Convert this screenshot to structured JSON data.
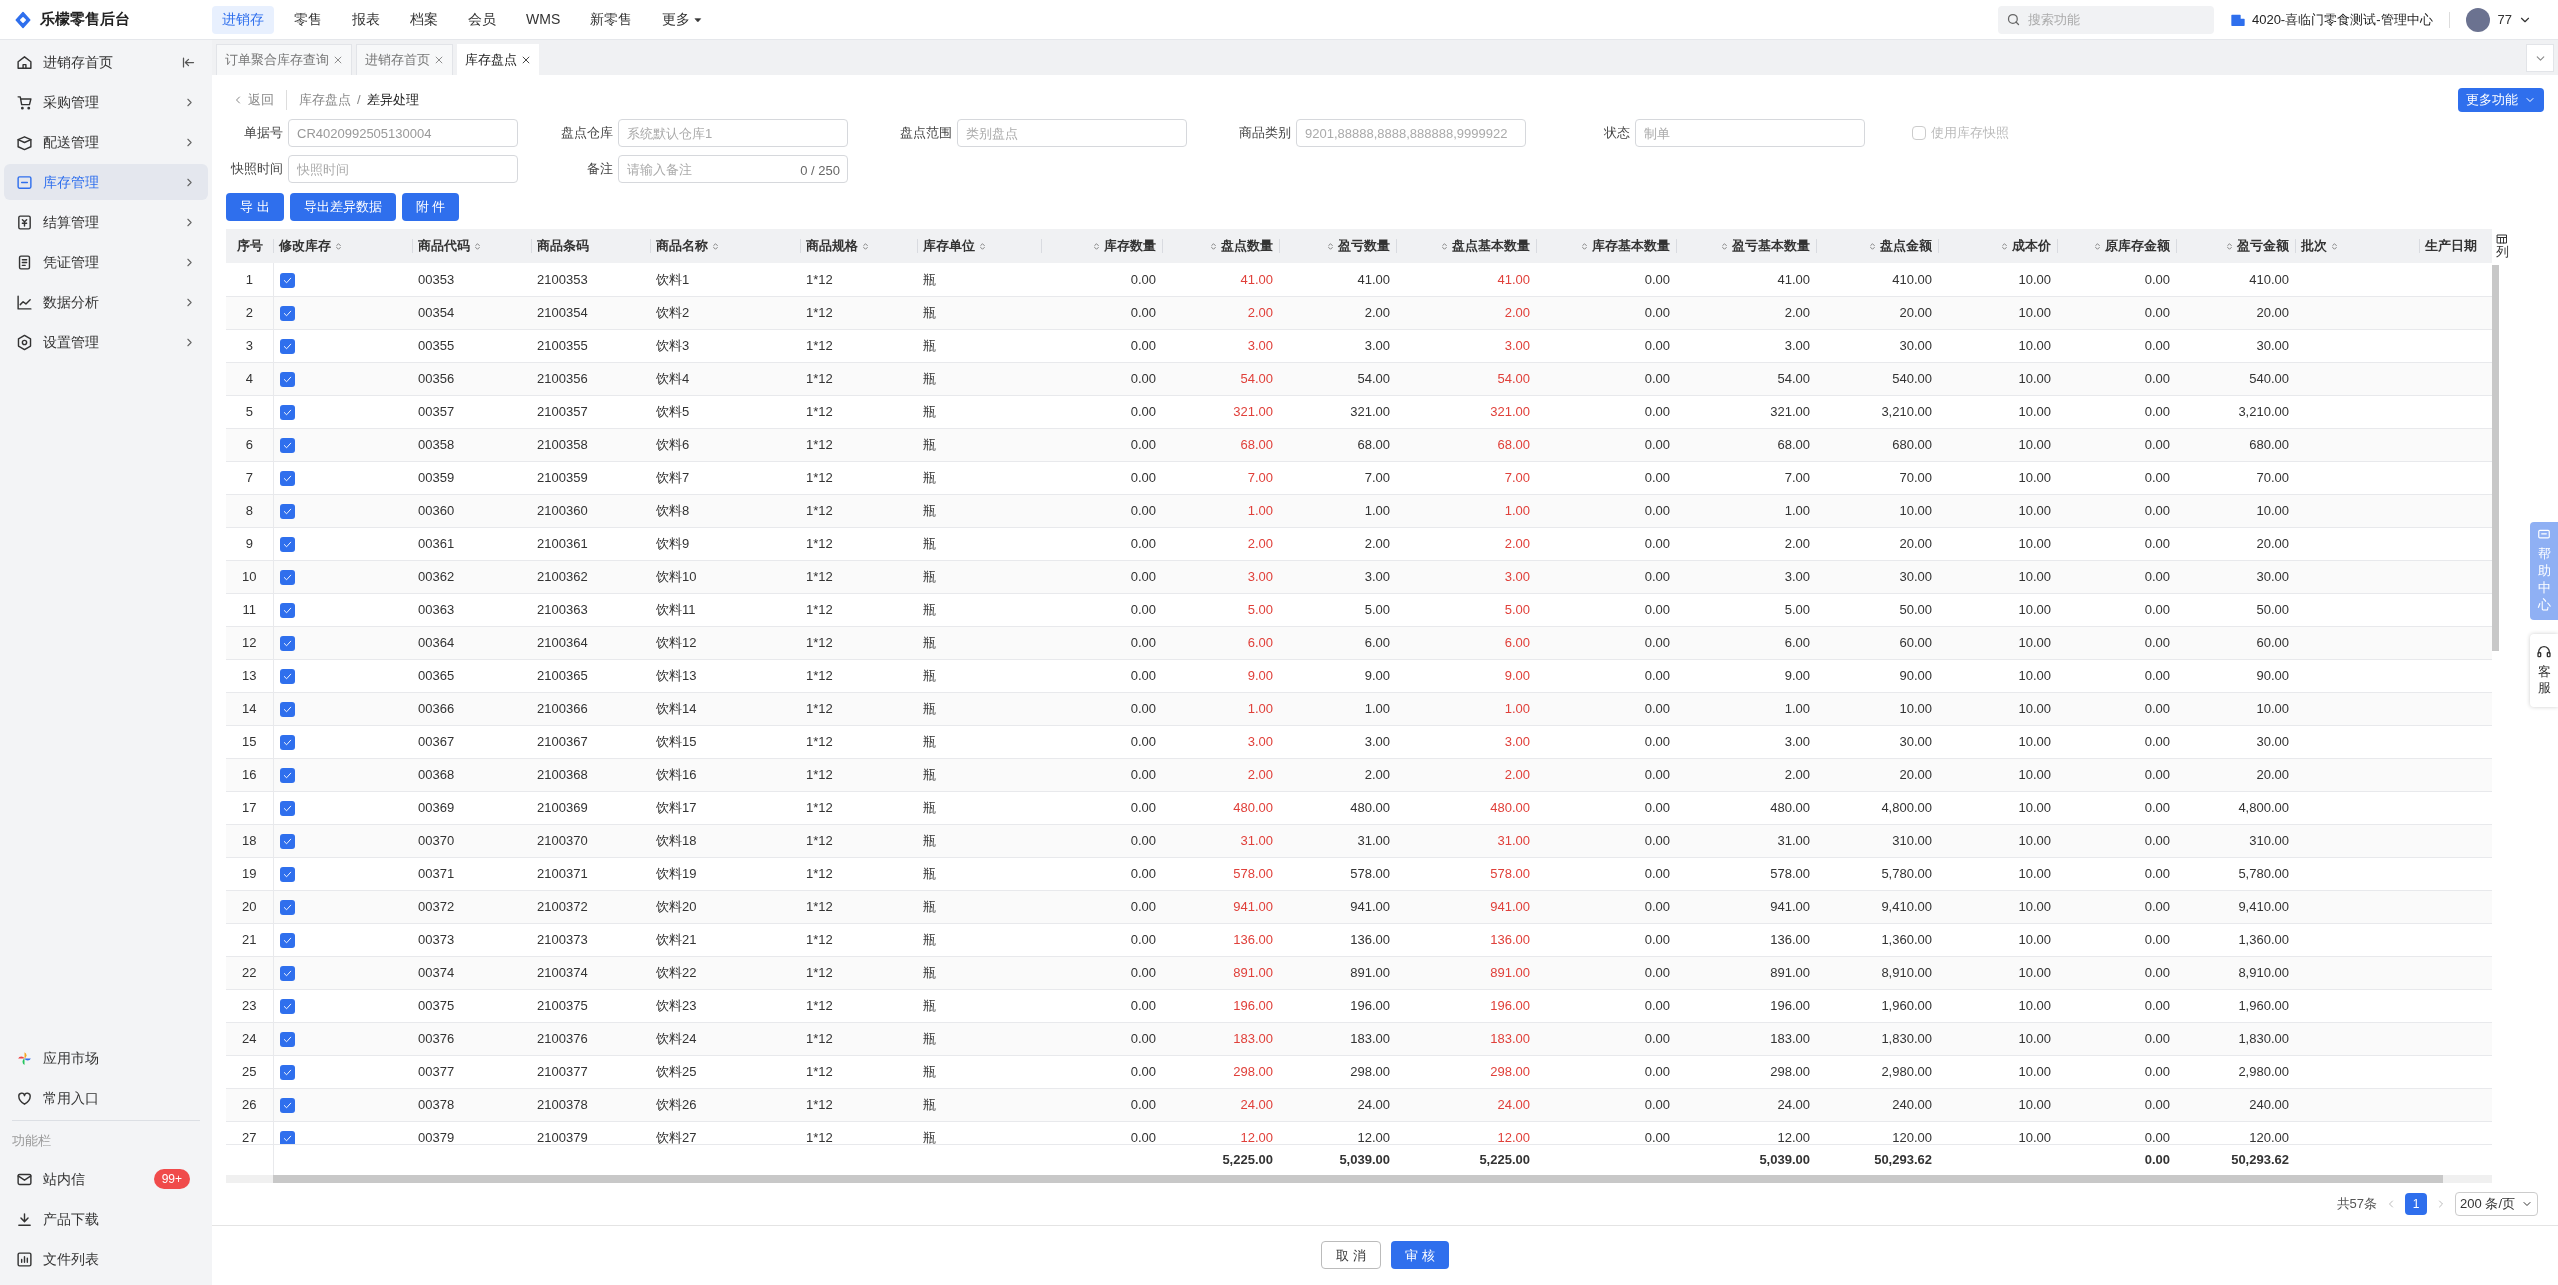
{
  "app": {
    "title": "乐檬零售后台"
  },
  "top_nav": [
    {
      "label": "进销存",
      "selected": true
    },
    {
      "label": "零售",
      "selected": false
    },
    {
      "label": "报表",
      "selected": false
    },
    {
      "label": "档案",
      "selected": false
    },
    {
      "label": "会员",
      "selected": false
    },
    {
      "label": "WMS",
      "selected": false
    },
    {
      "label": "新零售",
      "selected": false
    },
    {
      "label": "更多",
      "selected": false,
      "dropdown": true
    }
  ],
  "search": {
    "placeholder": "搜索功能"
  },
  "org": "4020-喜临门零食测试-管理中心",
  "user": "77",
  "sidebar": {
    "items": [
      {
        "label": "进销存首页",
        "selected": false
      },
      {
        "label": "采购管理",
        "selected": false
      },
      {
        "label": "配送管理",
        "selected": false
      },
      {
        "label": "库存管理",
        "selected": true
      },
      {
        "label": "结算管理",
        "selected": false
      },
      {
        "label": "凭证管理",
        "selected": false
      },
      {
        "label": "数据分析",
        "selected": false
      },
      {
        "label": "设置管理",
        "selected": false
      }
    ],
    "bottom": [
      {
        "label": "应用市场"
      },
      {
        "label": "常用入口"
      }
    ],
    "section": "功能栏",
    "tools": [
      {
        "label": "站内信",
        "badge": "99+"
      },
      {
        "label": "产品下载"
      },
      {
        "label": "文件列表"
      }
    ]
  },
  "tabs": [
    {
      "label": "订单聚合库存查询",
      "selected": false
    },
    {
      "label": "进销存首页",
      "selected": false
    },
    {
      "label": "库存盘点",
      "selected": true
    }
  ],
  "breadcrumb": {
    "back": "返回",
    "parent": "库存盘点",
    "separator": "/",
    "current": "差异处理"
  },
  "more_button": "更多功能",
  "form": [
    {
      "label": "单据号",
      "value": "CR4020992505130004"
    },
    {
      "label": "盘点仓库",
      "placeholder": "系统默认仓库1"
    },
    {
      "label": "盘点范围",
      "placeholder": "类别盘点"
    },
    {
      "label": "商品类别",
      "placeholder": "9201,88888,8888,888888,9999922"
    },
    {
      "label": "状态",
      "placeholder": "制单"
    },
    {
      "label": "快照时间",
      "placeholder": "快照时间"
    },
    {
      "label": "备注",
      "placeholder": "请输入备注",
      "counter": "0 / 250"
    }
  ],
  "snapshot_checkbox": {
    "label": "使用库存快照",
    "checked": false,
    "disabled": true
  },
  "actions": [
    "导 出",
    "导出差异数据",
    "附 件"
  ],
  "columns": [
    {
      "label": "序号",
      "kind": "index",
      "sortable": false
    },
    {
      "label": "修改库存",
      "kind": "checkbox",
      "sortable": true
    },
    {
      "label": "商品代码",
      "kind": "text",
      "sortable": true
    },
    {
      "label": "商品条码",
      "kind": "text",
      "sortable": false
    },
    {
      "label": "商品名称",
      "kind": "text",
      "sortable": true
    },
    {
      "label": "商品规格",
      "kind": "text",
      "sortable": true
    },
    {
      "label": "库存单位",
      "kind": "text",
      "sortable": true
    },
    {
      "label": "库存数量",
      "kind": "number",
      "sortable": true
    },
    {
      "label": "盘点数量",
      "kind": "number",
      "sortable": true,
      "emphasis": true,
      "total": "5,225.00"
    },
    {
      "label": "盈亏数量",
      "kind": "number",
      "sortable": true,
      "total": "5,039.00"
    },
    {
      "label": "盘点基本数量",
      "kind": "number",
      "sortable": true,
      "emphasis": true,
      "total": "5,225.00"
    },
    {
      "label": "库存基本数量",
      "kind": "number",
      "sortable": true
    },
    {
      "label": "盈亏基本数量",
      "kind": "number",
      "sortable": true,
      "total": "5,039.00"
    },
    {
      "label": "盘点金额",
      "kind": "number",
      "sortable": true,
      "total": "50,293.62"
    },
    {
      "label": "成本价",
      "kind": "number",
      "sortable": true
    },
    {
      "label": "原库存金额",
      "kind": "number",
      "sortable": true,
      "total": "0.00"
    },
    {
      "label": "盈亏金额",
      "kind": "number",
      "sortable": true,
      "total": "50,293.62"
    },
    {
      "label": "批次",
      "kind": "text",
      "sortable": true
    },
    {
      "label": "生产日期",
      "kind": "text",
      "sortable": false
    }
  ],
  "column_settings": "列",
  "rows": [
    {
      "checked": true,
      "cells": [
        "1",
        "00353",
        "2100353",
        "饮料1",
        "1*12",
        "瓶",
        "0.00",
        "41.00",
        "41.00",
        "41.00",
        "0.00",
        "41.00",
        "410.00",
        "10.00",
        "0.00",
        "410.00"
      ]
    },
    {
      "checked": true,
      "cells": [
        "2",
        "00354",
        "2100354",
        "饮料2",
        "1*12",
        "瓶",
        "0.00",
        "2.00",
        "2.00",
        "2.00",
        "0.00",
        "2.00",
        "20.00",
        "10.00",
        "0.00",
        "20.00"
      ]
    },
    {
      "checked": true,
      "cells": [
        "3",
        "00355",
        "2100355",
        "饮料3",
        "1*12",
        "瓶",
        "0.00",
        "3.00",
        "3.00",
        "3.00",
        "0.00",
        "3.00",
        "30.00",
        "10.00",
        "0.00",
        "30.00"
      ]
    },
    {
      "checked": true,
      "cells": [
        "4",
        "00356",
        "2100356",
        "饮料4",
        "1*12",
        "瓶",
        "0.00",
        "54.00",
        "54.00",
        "54.00",
        "0.00",
        "54.00",
        "540.00",
        "10.00",
        "0.00",
        "540.00"
      ]
    },
    {
      "checked": true,
      "cells": [
        "5",
        "00357",
        "2100357",
        "饮料5",
        "1*12",
        "瓶",
        "0.00",
        "321.00",
        "321.00",
        "321.00",
        "0.00",
        "321.00",
        "3,210.00",
        "10.00",
        "0.00",
        "3,210.00"
      ]
    },
    {
      "checked": true,
      "cells": [
        "6",
        "00358",
        "2100358",
        "饮料6",
        "1*12",
        "瓶",
        "0.00",
        "68.00",
        "68.00",
        "68.00",
        "0.00",
        "68.00",
        "680.00",
        "10.00",
        "0.00",
        "680.00"
      ]
    },
    {
      "checked": true,
      "cells": [
        "7",
        "00359",
        "2100359",
        "饮料7",
        "1*12",
        "瓶",
        "0.00",
        "7.00",
        "7.00",
        "7.00",
        "0.00",
        "7.00",
        "70.00",
        "10.00",
        "0.00",
        "70.00"
      ]
    },
    {
      "checked": true,
      "cells": [
        "8",
        "00360",
        "2100360",
        "饮料8",
        "1*12",
        "瓶",
        "0.00",
        "1.00",
        "1.00",
        "1.00",
        "0.00",
        "1.00",
        "10.00",
        "10.00",
        "0.00",
        "10.00"
      ]
    },
    {
      "checked": true,
      "cells": [
        "9",
        "00361",
        "2100361",
        "饮料9",
        "1*12",
        "瓶",
        "0.00",
        "2.00",
        "2.00",
        "2.00",
        "0.00",
        "2.00",
        "20.00",
        "10.00",
        "0.00",
        "20.00"
      ]
    },
    {
      "checked": true,
      "cells": [
        "10",
        "00362",
        "2100362",
        "饮料10",
        "1*12",
        "瓶",
        "0.00",
        "3.00",
        "3.00",
        "3.00",
        "0.00",
        "3.00",
        "30.00",
        "10.00",
        "0.00",
        "30.00"
      ]
    },
    {
      "checked": true,
      "cells": [
        "11",
        "00363",
        "2100363",
        "饮料11",
        "1*12",
        "瓶",
        "0.00",
        "5.00",
        "5.00",
        "5.00",
        "0.00",
        "5.00",
        "50.00",
        "10.00",
        "0.00",
        "50.00"
      ]
    },
    {
      "checked": true,
      "cells": [
        "12",
        "00364",
        "2100364",
        "饮料12",
        "1*12",
        "瓶",
        "0.00",
        "6.00",
        "6.00",
        "6.00",
        "0.00",
        "6.00",
        "60.00",
        "10.00",
        "0.00",
        "60.00"
      ]
    },
    {
      "checked": true,
      "cells": [
        "13",
        "00365",
        "2100365",
        "饮料13",
        "1*12",
        "瓶",
        "0.00",
        "9.00",
        "9.00",
        "9.00",
        "0.00",
        "9.00",
        "90.00",
        "10.00",
        "0.00",
        "90.00"
      ]
    },
    {
      "checked": true,
      "cells": [
        "14",
        "00366",
        "2100366",
        "饮料14",
        "1*12",
        "瓶",
        "0.00",
        "1.00",
        "1.00",
        "1.00",
        "0.00",
        "1.00",
        "10.00",
        "10.00",
        "0.00",
        "10.00"
      ]
    },
    {
      "checked": true,
      "cells": [
        "15",
        "00367",
        "2100367",
        "饮料15",
        "1*12",
        "瓶",
        "0.00",
        "3.00",
        "3.00",
        "3.00",
        "0.00",
        "3.00",
        "30.00",
        "10.00",
        "0.00",
        "30.00"
      ]
    },
    {
      "checked": true,
      "cells": [
        "16",
        "00368",
        "2100368",
        "饮料16",
        "1*12",
        "瓶",
        "0.00",
        "2.00",
        "2.00",
        "2.00",
        "0.00",
        "2.00",
        "20.00",
        "10.00",
        "0.00",
        "20.00"
      ]
    },
    {
      "checked": true,
      "cells": [
        "17",
        "00369",
        "2100369",
        "饮料17",
        "1*12",
        "瓶",
        "0.00",
        "480.00",
        "480.00",
        "480.00",
        "0.00",
        "480.00",
        "4,800.00",
        "10.00",
        "0.00",
        "4,800.00"
      ]
    },
    {
      "checked": true,
      "cells": [
        "18",
        "00370",
        "2100370",
        "饮料18",
        "1*12",
        "瓶",
        "0.00",
        "31.00",
        "31.00",
        "31.00",
        "0.00",
        "31.00",
        "310.00",
        "10.00",
        "0.00",
        "310.00"
      ]
    },
    {
      "checked": true,
      "cells": [
        "19",
        "00371",
        "2100371",
        "饮料19",
        "1*12",
        "瓶",
        "0.00",
        "578.00",
        "578.00",
        "578.00",
        "0.00",
        "578.00",
        "5,780.00",
        "10.00",
        "0.00",
        "5,780.00"
      ]
    },
    {
      "checked": true,
      "cells": [
        "20",
        "00372",
        "2100372",
        "饮料20",
        "1*12",
        "瓶",
        "0.00",
        "941.00",
        "941.00",
        "941.00",
        "0.00",
        "941.00",
        "9,410.00",
        "10.00",
        "0.00",
        "9,410.00"
      ]
    },
    {
      "checked": true,
      "cells": [
        "21",
        "00373",
        "2100373",
        "饮料21",
        "1*12",
        "瓶",
        "0.00",
        "136.00",
        "136.00",
        "136.00",
        "0.00",
        "136.00",
        "1,360.00",
        "10.00",
        "0.00",
        "1,360.00"
      ]
    },
    {
      "checked": true,
      "cells": [
        "22",
        "00374",
        "2100374",
        "饮料22",
        "1*12",
        "瓶",
        "0.00",
        "891.00",
        "891.00",
        "891.00",
        "0.00",
        "891.00",
        "8,910.00",
        "10.00",
        "0.00",
        "8,910.00"
      ]
    },
    {
      "checked": true,
      "cells": [
        "23",
        "00375",
        "2100375",
        "饮料23",
        "1*12",
        "瓶",
        "0.00",
        "196.00",
        "196.00",
        "196.00",
        "0.00",
        "196.00",
        "1,960.00",
        "10.00",
        "0.00",
        "1,960.00"
      ]
    },
    {
      "checked": true,
      "cells": [
        "24",
        "00376",
        "2100376",
        "饮料24",
        "1*12",
        "瓶",
        "0.00",
        "183.00",
        "183.00",
        "183.00",
        "0.00",
        "183.00",
        "1,830.00",
        "10.00",
        "0.00",
        "1,830.00"
      ]
    },
    {
      "checked": true,
      "cells": [
        "25",
        "00377",
        "2100377",
        "饮料25",
        "1*12",
        "瓶",
        "0.00",
        "298.00",
        "298.00",
        "298.00",
        "0.00",
        "298.00",
        "2,980.00",
        "10.00",
        "0.00",
        "2,980.00"
      ]
    },
    {
      "checked": true,
      "cells": [
        "26",
        "00378",
        "2100378",
        "饮料26",
        "1*12",
        "瓶",
        "0.00",
        "24.00",
        "24.00",
        "24.00",
        "0.00",
        "24.00",
        "240.00",
        "10.00",
        "0.00",
        "240.00"
      ]
    },
    {
      "checked": true,
      "cells": [
        "27",
        "00379",
        "2100379",
        "饮料27",
        "1*12",
        "瓶",
        "0.00",
        "12.00",
        "12.00",
        "12.00",
        "0.00",
        "12.00",
        "120.00",
        "10.00",
        "0.00",
        "120.00"
      ]
    }
  ],
  "pagination": {
    "total": "共57条",
    "pages": [
      {
        "label": "1",
        "selected": true
      }
    ],
    "page_size": "200 条/页"
  },
  "footer_buttons": [
    {
      "label": "取 消",
      "kind": "default"
    },
    {
      "label": "审 核",
      "kind": "primary"
    }
  ],
  "side_widgets": [
    {
      "label": "帮助中心",
      "kind": "help"
    },
    {
      "label": "客服",
      "kind": "service"
    }
  ]
}
